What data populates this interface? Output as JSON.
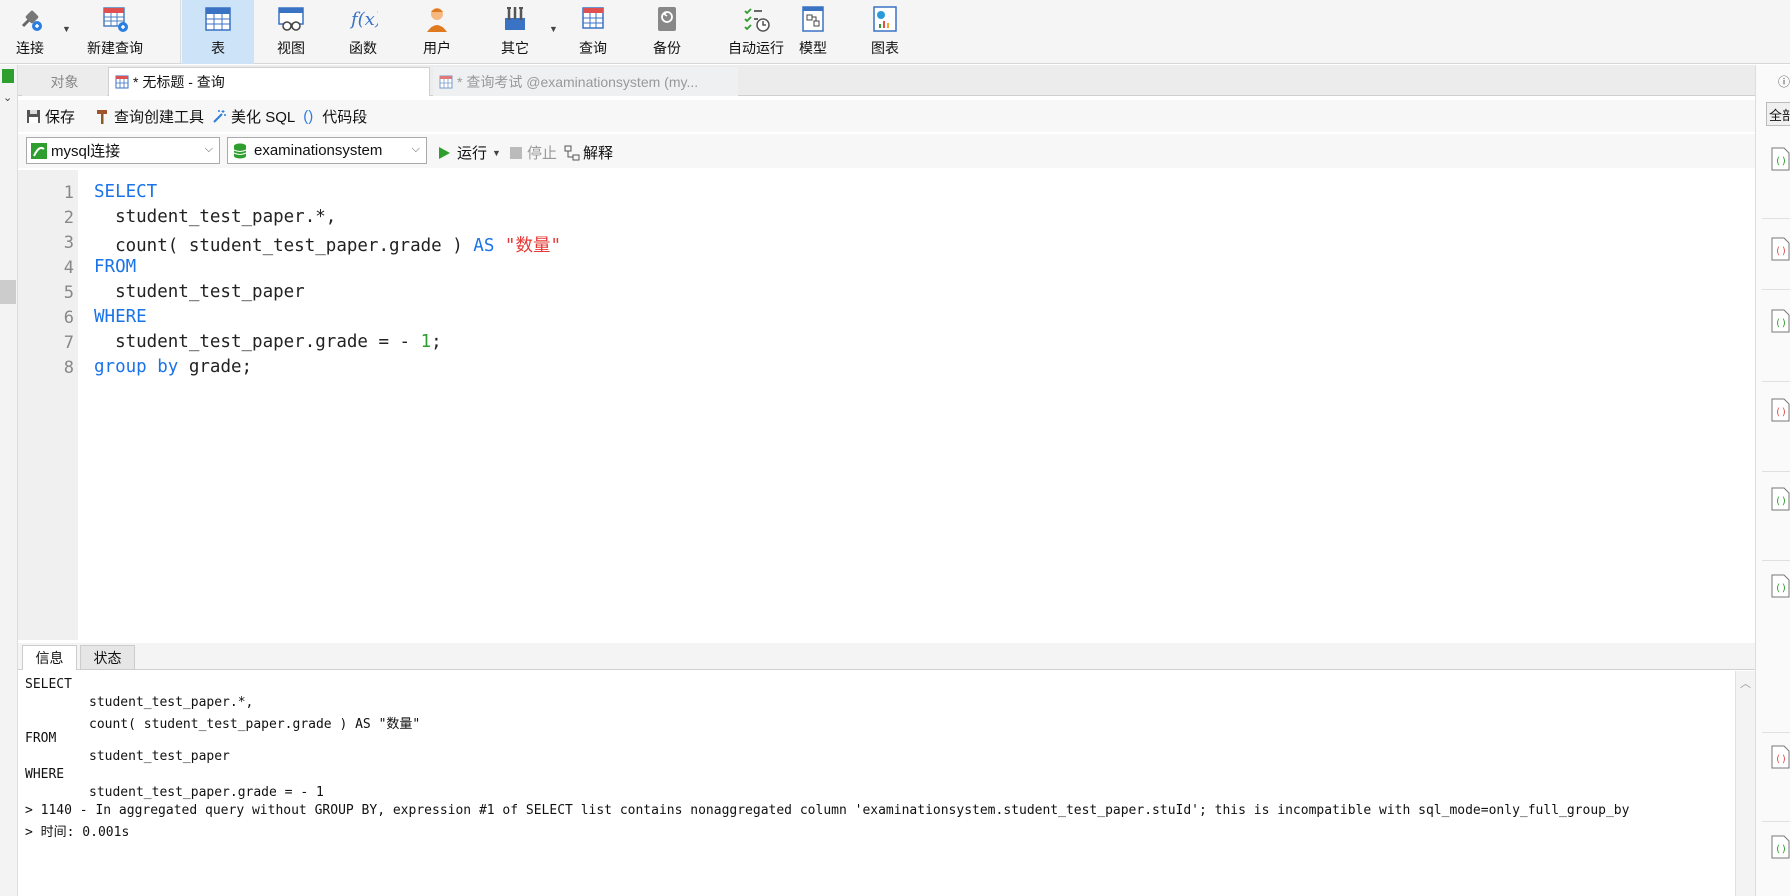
{
  "toolbar": {
    "items": [
      {
        "label": "连接",
        "icon": "plug-icon",
        "has_dropdown": true
      },
      {
        "label": "新建查询",
        "icon": "new-query-icon"
      },
      {
        "label": "表",
        "icon": "table-icon",
        "active": true
      },
      {
        "label": "视图",
        "icon": "view-icon"
      },
      {
        "label": "函数",
        "icon": "function-icon"
      },
      {
        "label": "用户",
        "icon": "user-icon"
      },
      {
        "label": "其它",
        "icon": "tools-icon",
        "has_dropdown": true
      },
      {
        "label": "查询",
        "icon": "query-icon"
      },
      {
        "label": "备份",
        "icon": "backup-icon"
      },
      {
        "label": "自动运行",
        "icon": "schedule-icon"
      },
      {
        "label": "模型",
        "icon": "model-icon"
      },
      {
        "label": "图表",
        "icon": "chart-icon"
      }
    ]
  },
  "tabs": {
    "objects": "对象",
    "current": "* 无标题 - 查询",
    "other": "* 查询考试 @examinationsystem (my..."
  },
  "actions": {
    "save": "保存",
    "query_builder": "查询创建工具",
    "beautify": "美化 SQL",
    "snippet": "代码段"
  },
  "selectors": {
    "connection": "mysql连接",
    "database": "examinationsystem"
  },
  "run_controls": {
    "run": "运行",
    "stop": "停止",
    "explain": "解释"
  },
  "editor": {
    "line_numbers": [
      "1",
      "2",
      "3",
      "4",
      "5",
      "6",
      "7",
      "8"
    ]
  },
  "message_tabs": {
    "info": "信息",
    "status": "状态"
  },
  "messages": {
    "lines": [
      "SELECT",
      "\tstudent_test_paper.*,",
      "\tcount( student_test_paper.grade ) AS \"数量\"",
      "FROM",
      "\tstudent_test_paper",
      "WHERE",
      "\tstudent_test_paper.grade = - 1",
      "> 1140 - In aggregated query without GROUP BY, expression #1 of SELECT list contains nonaggregated column 'examinationsystem.student_test_paper.stuId'; this is incompatible with sql_mode=only_full_group_by",
      "> 时间: 0.001s"
    ]
  },
  "right_panel": {
    "all_label": "全部"
  },
  "colors": {
    "keyword": "#1a73e8",
    "string": "#e53935",
    "number": "#2e9e2e",
    "active_tab_bg": "#cde3f7"
  }
}
